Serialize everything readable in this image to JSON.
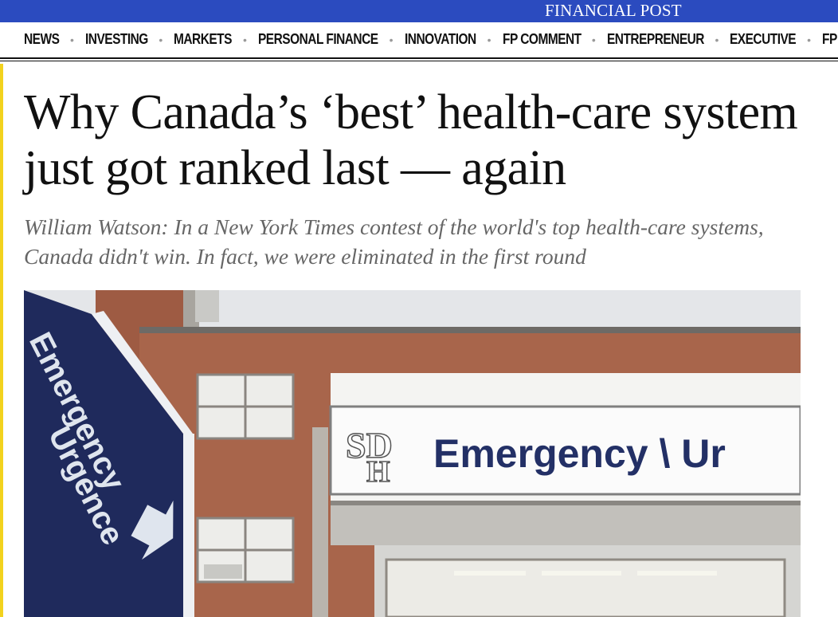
{
  "site": {
    "brand": "FINANCIAL POST"
  },
  "nav": {
    "items": [
      "NEWS",
      "INVESTING",
      "MARKETS",
      "PERSONAL FINANCE",
      "INNOVATION",
      "FP COMMENT",
      "ENTREPRENEUR",
      "EXECUTIVE",
      "FP MAGAZINE"
    ],
    "separator": "•"
  },
  "article": {
    "headline": "Why Canada’s ‘best’ health-care system just got ranked last — again",
    "subhead": "William Watson: In a New York Times contest of the world's top health-care systems, Canada didn't win. In fact, we were eliminated in the first round",
    "photo": {
      "sign_left_line1": "Emergency",
      "sign_left_line2": "Urgence",
      "sign_logo_top": "SD",
      "sign_logo_bottom": "H",
      "sign_main": "Emergency \\ Ur"
    }
  },
  "colors": {
    "topbar": "#2b4bbf",
    "accent_bar": "#f2d21e",
    "sign_blue": "#1f2a5c"
  }
}
